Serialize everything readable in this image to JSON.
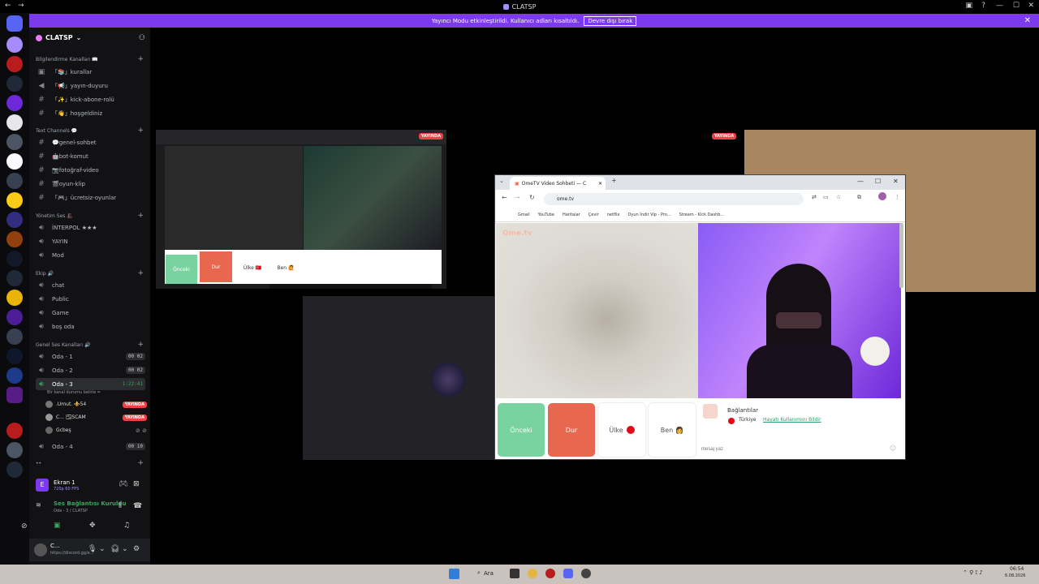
{
  "window": {
    "title": "CLATSP"
  },
  "banner": {
    "text": "Yayıncı Modu etkinleştirildi. Kullanıcı adları kısaltıldı.",
    "button": "Devre dışı bırak"
  },
  "server": {
    "name": "CLATSP"
  },
  "categories": {
    "info": "Bilgilendirme Kanalları 📖",
    "text": "Text Channels 💬",
    "mgmt": "Yönetim Ses 🎩",
    "team": "Ekip 🔊",
    "voice": "Genel Ses Kanalları 🔊"
  },
  "channels": {
    "kurallar": "「📚」kurallar",
    "duyuru": "「📢」yayın-duyuru",
    "kick": "「✨」kick-abone-rolü",
    "hosgeldiniz": "「👋」hoşgeldiniz",
    "genel": "💬genel-sohbet",
    "bot": "🤖bot-komut",
    "foto": "📷fotoğraf-video",
    "oyun": "🎬oyun-klip",
    "ucretsiz": "「🎮」ücretsiz-oyunlar",
    "interpol": "İNTERPOL ★★★",
    "yayin": "YAYIN",
    "mod": "Mod",
    "chat": "chat",
    "public": "Public",
    "game": "Game",
    "bos": "boş oda",
    "oda1": "Oda - 1",
    "oda2": "Oda - 2",
    "oda3": "Oda - 3",
    "oda4": "Oda - 4",
    "oda1_count": "00 02",
    "oda2_count": "00 02",
    "oda3_timer": "1:22:41",
    "oda4_count": "00 10",
    "oda3_status": "Bir kanal durumu belirle ✏",
    "more": "••"
  },
  "members": [
    {
      "name": ".Umut. ⚜️54",
      "live": "YAYINDA"
    },
    {
      "name": "C... 🌫SCAM",
      "live": "YAYINDA"
    },
    {
      "name": "Gcbeş",
      "live": ""
    }
  ],
  "screen": {
    "title": "Ekran 1",
    "sub": "720p 60 FPS"
  },
  "voice": {
    "status": "Ses Bağlantısı Kuruldu",
    "channel": "Oda - 3 / CLATSP"
  },
  "user": {
    "name": "C...",
    "status": "https://discord.gg/e..."
  },
  "stream": {
    "live_label": "YAYINDA"
  },
  "mini_ome": {
    "prev": "Önceki",
    "stop": "Dur",
    "country": "Ülke 🇹🇷",
    "me": "Ben 🙋"
  },
  "browser": {
    "tab_title": "OmeTV Video Sohbeti — C",
    "url": "ome.tv",
    "bookmarks": [
      "Gmail",
      "YouTube",
      "Haritalar",
      "Çevir",
      "netflix",
      "Oyun İndir Vip - Pro...",
      "Stream - Kick Dashb..."
    ],
    "logo": "Ome.tv",
    "buttons": {
      "prev": "Önceki",
      "stop": "Dur",
      "country": "Ülke",
      "me": "Ben"
    },
    "chat": {
      "title": "Bağlantılar",
      "country": "Türkiye",
      "link": "Hayatı Kullanımını Bildir",
      "placeholder": "mesaj yaz"
    }
  },
  "taskbar": {
    "search": "Ara",
    "time": "06:54",
    "date": "6.08.2026"
  },
  "colors": {
    "accent": "#7c3aed",
    "live": "#ed4245",
    "green": "#3ba55d",
    "ome_green": "#79d3a0",
    "ome_red": "#e8684f"
  }
}
